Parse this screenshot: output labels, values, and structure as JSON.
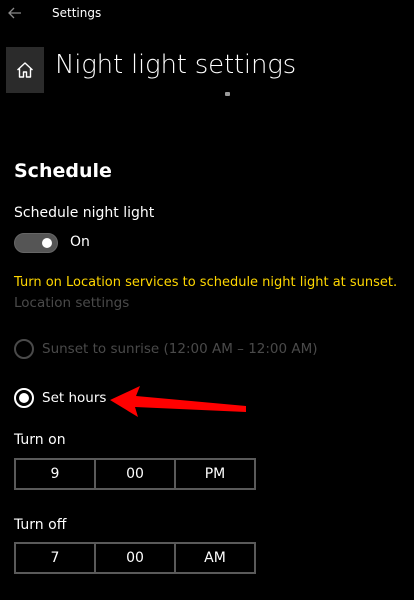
{
  "titlebar": {
    "app_title": "Settings",
    "back_icon": "back-arrow-icon"
  },
  "header": {
    "home_icon": "home-icon",
    "title": "Night light settings"
  },
  "schedule": {
    "section_title": "Schedule",
    "toggle_label": "Schedule night light",
    "toggle_state": "On",
    "toggle_on": true,
    "warning_text": "Turn on Location services to schedule night light at sunset.",
    "location_link": "Location settings",
    "options": [
      {
        "label": "Sunset to sunrise (12:00 AM – 12:00 AM)",
        "selected": false,
        "disabled": true
      },
      {
        "label": "Set hours",
        "selected": true,
        "disabled": false
      }
    ]
  },
  "turn_on": {
    "label": "Turn on",
    "hour": "9",
    "minute": "00",
    "period": "PM"
  },
  "turn_off": {
    "label": "Turn off",
    "hour": "7",
    "minute": "00",
    "period": "AM"
  },
  "colors": {
    "background": "#000000",
    "text": "#ffffff",
    "warning": "#ffd700",
    "disabled": "#4a4a4a",
    "annotation": "#ff0000"
  }
}
